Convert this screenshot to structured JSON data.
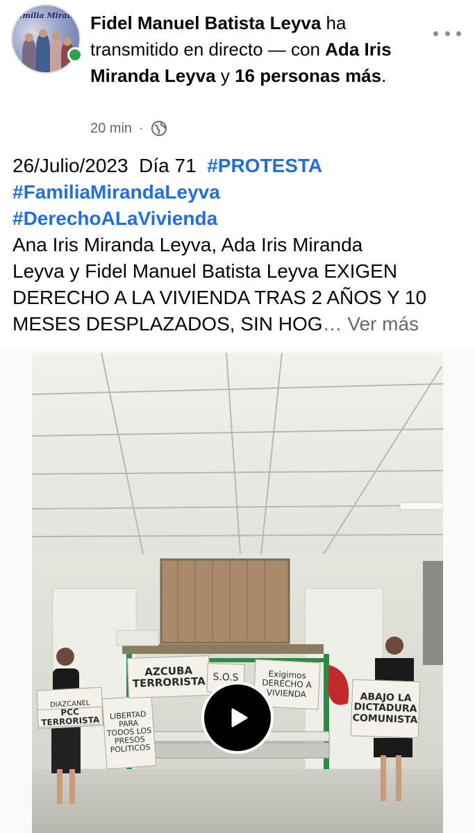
{
  "header": {
    "avatar_banner": "Familia Miranda Leyva",
    "author": "Fidel Manuel Batista Leyva",
    "action": " ha transmitido en directo — con ",
    "tagged": "Ada Iris Miranda Leyva",
    "and": " y ",
    "others": "16 personas más",
    "end": ".",
    "time": "20 min",
    "separator": "·",
    "audience_icon": "globe-icon",
    "online_color": "#31a24c"
  },
  "post": {
    "date": "26/Julio/2023",
    "day": "Día 71",
    "hashtags": [
      "#PROTESTA",
      "#FamiliaMirandaLeyva",
      "#DerechoALaVivienda"
    ],
    "body_lines": [
      "Ana Iris Miranda Leyva, Ada Iris Miranda",
      "Leyva y Fidel Manuel Batista Leyva EXIGEN",
      "DERECHO A LA VIVIENDA TRAS 2 AÑOS Y 10"
    ],
    "last_line": "MESES DESPLAZADOS, SIN HOG",
    "ellipsis": "…",
    "see_more": "Ver más",
    "hashtag_color": "#216fdb"
  },
  "video": {
    "signs": [
      "DIAZCANEL ASESINO",
      "PCC TERRORISTA",
      "LIBERTAD PARA TODOS LOS PRESOS POLITICOS",
      "AZCUBA TERRORISTA",
      "S.O.S",
      "Exigimos DERECHO A VIVIENDA",
      "ABAJO LA DICTADURA COMUNISTA"
    ],
    "play_icon": "play-icon"
  }
}
